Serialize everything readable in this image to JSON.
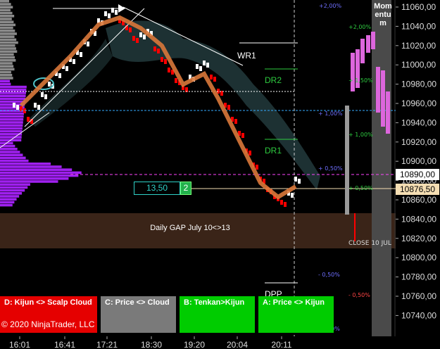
{
  "price_axis": {
    "labels": [
      "11060,00",
      "11040,00",
      "11020,00",
      "11000,00",
      "10980,00",
      "10960,00",
      "10940,00",
      "10920,00",
      "10900,00",
      "10880,00",
      "10860,00",
      "10840,00",
      "10820,00",
      "10800,00",
      "10780,00",
      "10760,00",
      "10740,00"
    ],
    "current_price": "10890,00",
    "last_price": "10876,50"
  },
  "time_axis": {
    "labels": [
      "16:01",
      "16:41",
      "17:21",
      "18:30",
      "19:20",
      "20:04",
      "20:11"
    ]
  },
  "levels": {
    "wr1": "WR1",
    "dr2": "DR2",
    "dr1": "DR1",
    "dpp": "DPP",
    "close": "CLOSE 10 JUL"
  },
  "percent_labels": {
    "p200a": "+2,00%",
    "p200b": "+2,00%",
    "p150": "+ 1,50%",
    "p100a": "+ 1,00%",
    "p100b": "+ 1,00%",
    "p050a": "+ 0,50%",
    "p050b": "+ 0,50%",
    "m050a": "- 0,50%",
    "m050b": "- 0,50%",
    "m100": "- 1,00%"
  },
  "gap": {
    "label": "Daily GAP July 10<>13"
  },
  "order": {
    "stop_value": "13,50",
    "quantity": "2"
  },
  "momentum": {
    "label": "Mom entu m"
  },
  "buttons": [
    {
      "id": "d",
      "label": "D: Kijun <> Scalp Cloud",
      "color": "#e50000"
    },
    {
      "id": "c",
      "label": "C: Price <> Cloud",
      "color": "#7a7a7a"
    },
    {
      "id": "b",
      "label": "B: Tenkan>Kijun",
      "color": "#00cc00"
    },
    {
      "id": "a",
      "label": "A: Price <> Kijun",
      "color": "#00cc00"
    }
  ],
  "copyright": "© 2020 NinjaTrader, LLC",
  "colors": {
    "bull": "#ffffff",
    "bear": "#ff0000",
    "profile_gray": "#8a8a8a",
    "profile_purple": "#a020f0",
    "kijun": "#d9783a",
    "cloud": "#2a4648",
    "momentum_pink": "#dd66dd",
    "current_tag": "#ffffff",
    "last_tag": "#f5deb3"
  }
}
